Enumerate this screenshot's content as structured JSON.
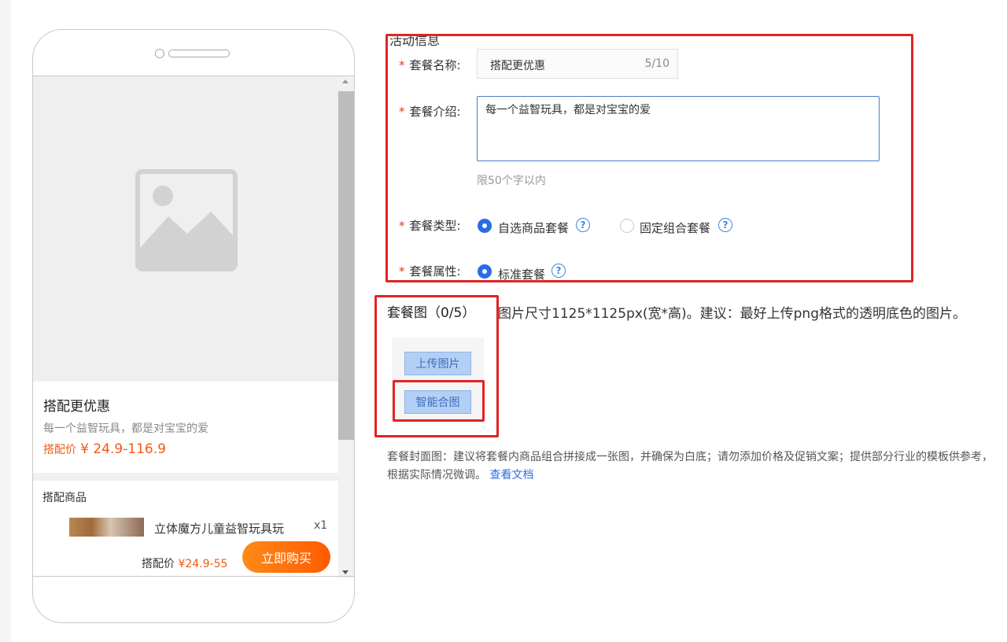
{
  "preview": {
    "package_name": "搭配更优惠",
    "package_desc": "每一个益智玩具，都是对宝宝的爱",
    "price_label": "搭配价",
    "price_value": "¥ 24.9-116.9",
    "goods_section_title": "搭配商品",
    "goods": [
      {
        "name": "立体魔方儿童益智玩具玩",
        "qty": "x1"
      }
    ],
    "bottom_price_label": "搭配价",
    "bottom_price_value": "¥24.9-55",
    "buy_button": "立即购买"
  },
  "form": {
    "section_title": "活动信息",
    "name_label": "套餐名称:",
    "name_value": "搭配更优惠",
    "name_counter": "5/10",
    "desc_label": "套餐介绍:",
    "desc_value": "每一个益智玩具，都是对宝宝的爱",
    "desc_hint": "限50个字以内",
    "type_label": "套餐类型:",
    "type_options": [
      "自选商品套餐",
      "固定组合套餐"
    ],
    "type_selected": "自选商品套餐",
    "attr_label": "套餐属性:",
    "attr_options": [
      "标准套餐"
    ],
    "attr_selected": "标准套餐",
    "required_mark": "*",
    "help_glyph": "?"
  },
  "images": {
    "section_title": "套餐图（0/5）",
    "size_tip": "图片尺寸1125*1125px(宽*高)。建议：最好上传png格式的透明底色的图片。",
    "upload_button": "上传图片",
    "smart_button": "智能合图",
    "cover_note": "套餐封面图：建议将套餐内商品组合拼接成一张图，并确保为白底；请勿添加价格及促销文案；提供部分行业的模板供参考，",
    "cover_note_2": "根据实际情况微调。",
    "doc_link": "查看文档"
  },
  "colors": {
    "accent": "#2a6de3",
    "price": "#f25a12",
    "annotation": "#e02424",
    "buy_button": "#ff6a0a"
  }
}
